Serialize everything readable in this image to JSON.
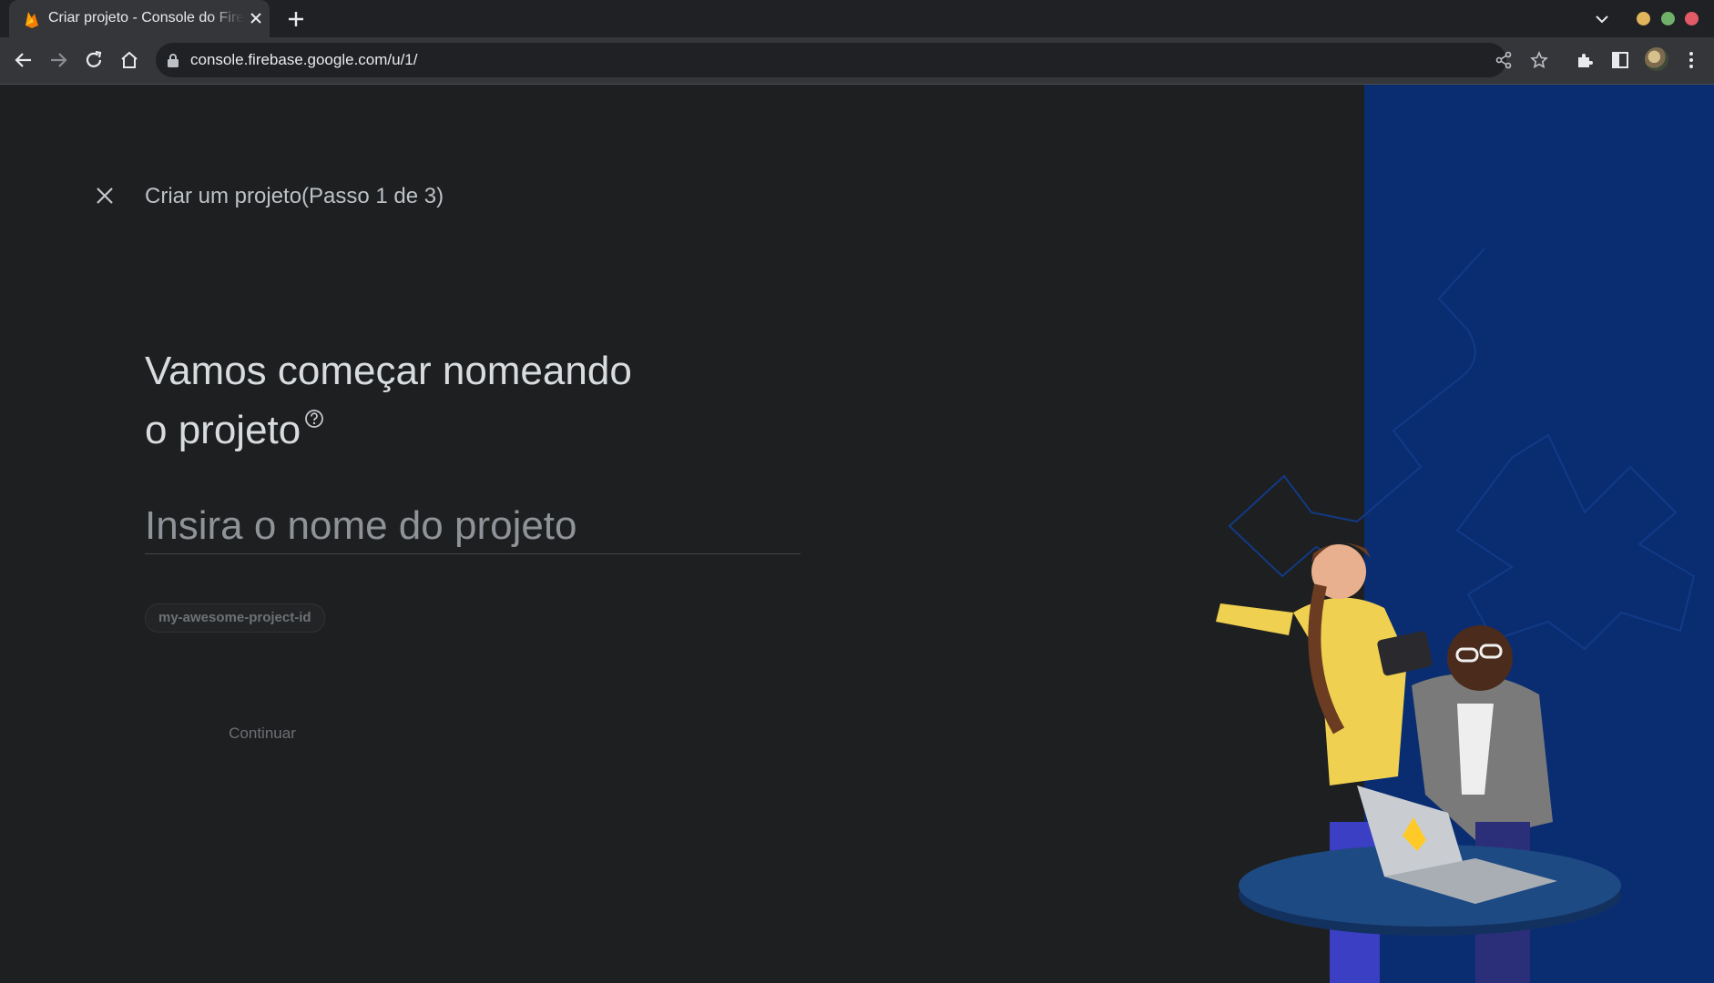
{
  "browser": {
    "tab_title": "Criar projeto - Console do Firebase",
    "url": "console.firebase.google.com/u/1/"
  },
  "page": {
    "header_title": "Criar um projeto(Passo 1 de 3)",
    "headline_line1": "Vamos começar nomeando",
    "headline_line2": "o projeto",
    "name_placeholder": "Insira o nome do projeto",
    "project_id_chip": "my-awesome-project-id",
    "continue_label": "Continuar"
  },
  "colors": {
    "page_bg": "#1d1f20",
    "panel_blue": "#0a2d72",
    "firebase_yellow": "#ffca28"
  },
  "icons": [
    "firebase-icon",
    "close-icon",
    "plus-icon",
    "chevron-down-icon",
    "back-icon",
    "forward-icon",
    "reload-icon",
    "home-icon",
    "lock-icon",
    "share-icon",
    "star-icon",
    "extensions-icon",
    "sidebar-icon",
    "menu-icon",
    "help-icon"
  ]
}
